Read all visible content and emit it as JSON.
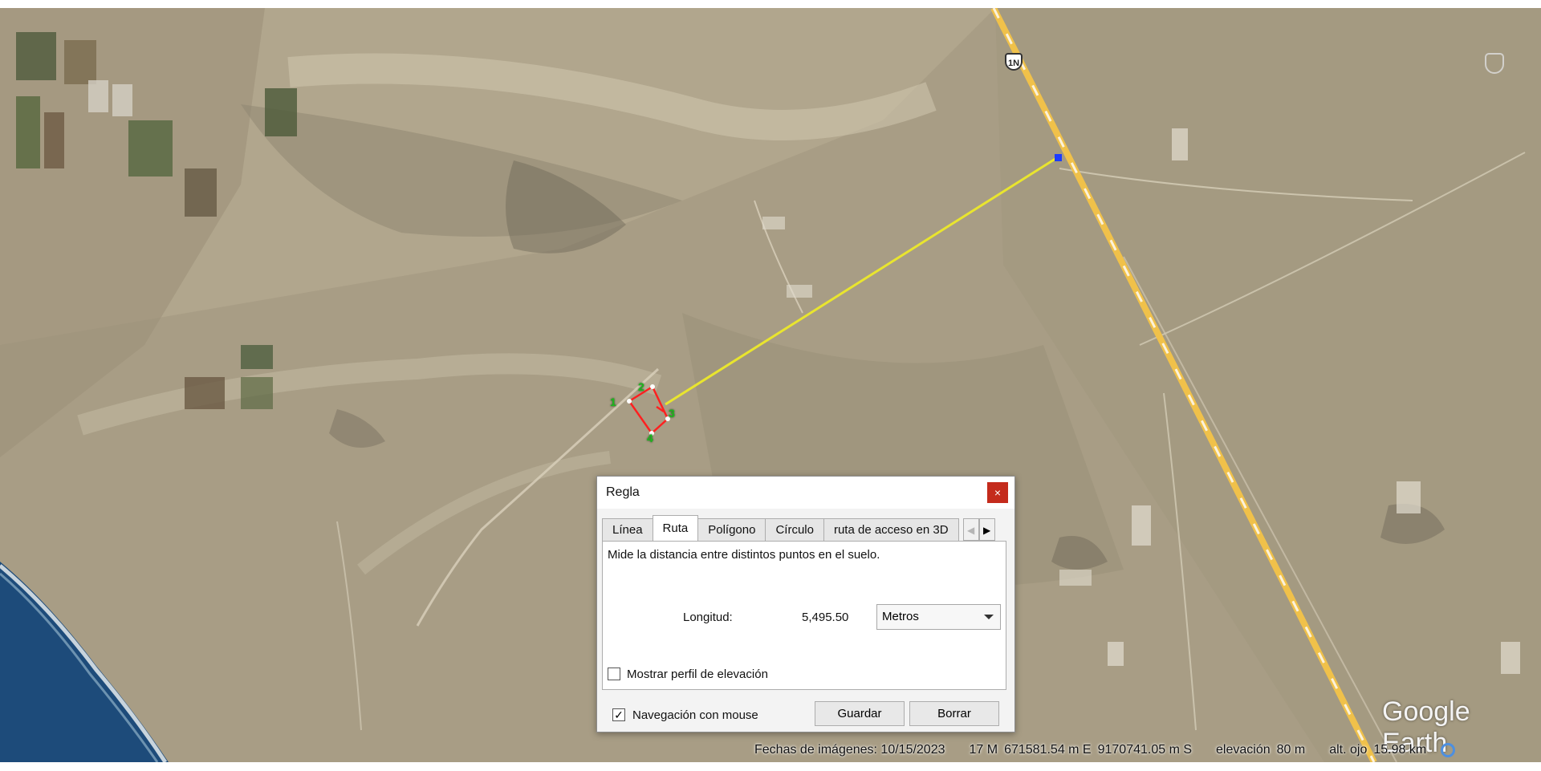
{
  "map": {
    "route_shield": "1N",
    "point_labels": [
      "1",
      "2",
      "3",
      "4"
    ],
    "watermark": "Google Earth",
    "route_color": "#e9e52e",
    "polygon_color": "#ff2020",
    "highway_color": "#f0c14a",
    "endpoint_color": "#1c3cff"
  },
  "statusbar": {
    "imagery_date": "Fechas de imágenes: 10/15/2023",
    "coord_zone": "17 M",
    "coord_easting": "671581.54 m E",
    "coord_northing": "9170741.05 m S",
    "elevation_label": "elevación",
    "elevation_value": "80 m",
    "eye_altitude_label": "alt. ojo",
    "eye_altitude_value": "15.98 km"
  },
  "ruler": {
    "title": "Regla",
    "close_icon": "×",
    "tabs": [
      {
        "label": "Línea",
        "active": false
      },
      {
        "label": "Ruta",
        "active": true
      },
      {
        "label": "Polígono",
        "active": false
      },
      {
        "label": "Círculo",
        "active": false
      },
      {
        "label": "ruta de acceso en 3D",
        "active": false
      }
    ],
    "description": "Mide la distancia entre distintos puntos en el suelo.",
    "length_label": "Longitud:",
    "length_value": "5,495.50",
    "unit_selected": "Metros",
    "show_elevation_profile_label": "Mostrar perfil de elevación",
    "show_elevation_profile_checked": false,
    "mouse_navigation_label": "Navegación con mouse",
    "mouse_navigation_checked": true,
    "save_label": "Guardar",
    "clear_label": "Borrar"
  }
}
